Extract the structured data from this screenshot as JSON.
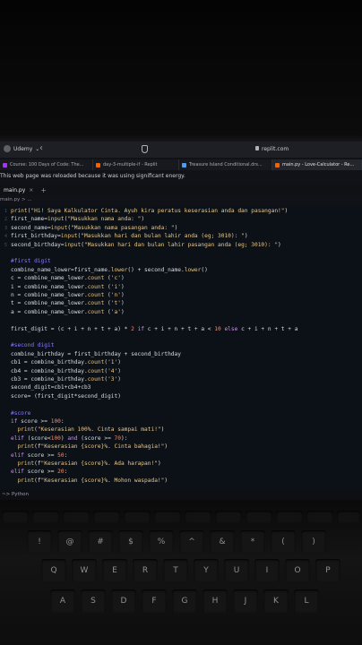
{
  "browser": {
    "profile_label": "Udemy",
    "url": "replit.com",
    "tabs": [
      {
        "label": "Course: 100 Days of Code: The...",
        "color": "#a435f0"
      },
      {
        "label": "day-3-multiple-if - Replit",
        "color": "#f26207"
      },
      {
        "label": "Treasure Island Conditional.drs...",
        "color": "#4a9ff5"
      },
      {
        "label": "main.py - Love-Calculator - Re...",
        "color": "#f26207"
      }
    ]
  },
  "notice": "This web page was reloaded because it was using significant energy.",
  "editor": {
    "file_tab": "main.py",
    "file_close": "×",
    "add_tab": "+",
    "breadcrumb": "main.py > ...",
    "console_label": "~> Python"
  },
  "code_lines": [
    {
      "n": "1",
      "text": "print(\"Hi! Saya Kalkulator Cinta. Ayuh kira peratus keserasian anda dan pasangan!\")"
    },
    {
      "n": "2",
      "text": "first_name=input(\"Masukkan nama anda: \")"
    },
    {
      "n": "3",
      "text": "second_name=input(\"Masukkan nama pasangan anda: \")"
    },
    {
      "n": "4",
      "text": "first_birthday=input(\"Masukkan hari dan bulan lahir anda (eg; 3010): \")"
    },
    {
      "n": "5",
      "text": "second_birthday=input(\"Masukkan hari dan bulan lahir pasangan anda (eg; 3010): \")"
    },
    {
      "n": "",
      "text": ""
    },
    {
      "n": "",
      "text": "#first digit"
    },
    {
      "n": "",
      "text": "combine_name_lower=first_name.lower() + second_name.lower()"
    },
    {
      "n": "",
      "text": "c = combine_name_lower.count ('c')"
    },
    {
      "n": "",
      "text": "i = combine_name_lower.count ('i')"
    },
    {
      "n": "",
      "text": "n = combine_name_lower.count ('n')"
    },
    {
      "n": "",
      "text": "t = combine_name_lower.count ('t')"
    },
    {
      "n": "",
      "text": "a = combine_name_lower.count ('a')"
    },
    {
      "n": "",
      "text": ""
    },
    {
      "n": "",
      "text": "first_digit = (c + i + n + t + a) * 2 if c + i + n + t + a < 10 else c + i + n + t + a"
    },
    {
      "n": "",
      "text": ""
    },
    {
      "n": "",
      "text": "#second digit"
    },
    {
      "n": "",
      "text": "combine_birthday = first_birthday + second_birthday"
    },
    {
      "n": "",
      "text": "cb1 = combine_birthday.count('1')"
    },
    {
      "n": "",
      "text": "cb4 = combine_birthday.count('4')"
    },
    {
      "n": "",
      "text": "cb3 = combine_birthday.count('3')"
    },
    {
      "n": "",
      "text": "second_digit=cb1+cb4+cb3"
    },
    {
      "n": "",
      "text": "score= (first_digit*second_digit)"
    },
    {
      "n": "",
      "text": ""
    },
    {
      "n": "",
      "text": "#score"
    },
    {
      "n": "",
      "text": "if score >= 100:"
    },
    {
      "n": "",
      "text": "  print(\"Keserasian 100%. Cinta sampai mati!\")"
    },
    {
      "n": "",
      "text": "elif (score<100) and (score >= 70):"
    },
    {
      "n": "",
      "text": "  print(f\"Keserasian {score}%. Cinta bahagia!\")"
    },
    {
      "n": "",
      "text": "elif score >= 50:"
    },
    {
      "n": "",
      "text": "  print(f\"Keserasian {score}%. Ada harapan!\")"
    },
    {
      "n": "",
      "text": "elif score >= 20:"
    },
    {
      "n": "",
      "text": "  print(f\"Keserasian {score}%. Mohon waspada!\")"
    }
  ],
  "keyboard": {
    "row_numbers": [
      "!",
      "@",
      "#",
      "$",
      "%",
      "^",
      "&",
      "*",
      "(",
      ")"
    ],
    "row_top": [
      "Q",
      "W",
      "E",
      "R",
      "T",
      "Y",
      "U",
      "I",
      "O",
      "P"
    ],
    "row_mid": [
      "A",
      "S",
      "D",
      "F",
      "G",
      "H",
      "J",
      "K",
      "L"
    ]
  }
}
